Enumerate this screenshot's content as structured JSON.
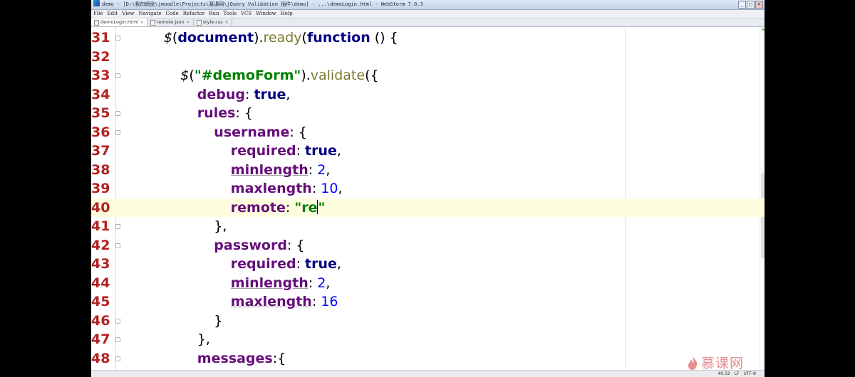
{
  "window": {
    "title": "demo - [D:\\我的網盘\\jmoodle\\Projects\\慕课网\\jQuery Validation 插件\\demo] - ...\\demoLogin.html - WebStorm 7.0.3",
    "controls": [
      "_",
      "□",
      "×"
    ]
  },
  "menu": [
    "File",
    "Edit",
    "View",
    "Navigate",
    "Code",
    "Refactor",
    "Run",
    "Tools",
    "VCS",
    "Window",
    "Help"
  ],
  "tabs": [
    {
      "label": "demoLogin.html",
      "close": "×",
      "active": true
    },
    {
      "label": "remote.json",
      "close": "×",
      "active": false
    },
    {
      "label": "style.css",
      "close": "×",
      "active": false
    }
  ],
  "code_lines": [
    {
      "num": "31",
      "tokens": [
        [
          "dollar",
          "$"
        ],
        [
          "pun",
          "("
        ],
        [
          "kw",
          "document"
        ],
        [
          "pun",
          ")."
        ],
        [
          "fn",
          "ready"
        ],
        [
          "pun",
          "("
        ],
        [
          "kw",
          "function"
        ],
        [
          "pun",
          " () {"
        ]
      ]
    },
    {
      "num": "32",
      "tokens": []
    },
    {
      "num": "33",
      "tokens": [
        [
          "dollar",
          "$"
        ],
        [
          "pun",
          "("
        ],
        [
          "str",
          "\"#demoForm\""
        ],
        [
          "pun",
          ")."
        ],
        [
          "fn",
          "validate"
        ],
        [
          "pun",
          "({"
        ]
      ]
    },
    {
      "num": "34",
      "tokens": [
        [
          "prop",
          "debug"
        ],
        [
          "pun",
          ": "
        ],
        [
          "kw",
          "true"
        ],
        [
          "pun",
          ","
        ]
      ]
    },
    {
      "num": "35",
      "tokens": [
        [
          "prop",
          "rules"
        ],
        [
          "pun",
          ": {"
        ]
      ]
    },
    {
      "num": "36",
      "tokens": [
        [
          "prop",
          "username"
        ],
        [
          "pun",
          ": {"
        ]
      ]
    },
    {
      "num": "37",
      "tokens": [
        [
          "prop",
          "required"
        ],
        [
          "pun",
          ": "
        ],
        [
          "kw",
          "true"
        ],
        [
          "pun",
          ","
        ]
      ]
    },
    {
      "num": "38",
      "tokens": [
        [
          "prop ul",
          "minlength"
        ],
        [
          "pun",
          ": "
        ],
        [
          "num",
          "2"
        ],
        [
          "pun",
          ","
        ]
      ]
    },
    {
      "num": "39",
      "tokens": [
        [
          "prop",
          "maxlength"
        ],
        [
          "pun",
          ": "
        ],
        [
          "num",
          "10"
        ],
        [
          "pun",
          ","
        ]
      ]
    },
    {
      "num": "40",
      "tokens": [
        [
          "prop",
          "remote"
        ],
        [
          "pun",
          ": "
        ],
        [
          "str",
          "\"re"
        ],
        [
          "caret",
          ""
        ],
        [
          "str",
          "\""
        ]
      ]
    },
    {
      "num": "41",
      "tokens": [
        [
          "pun",
          "},"
        ]
      ]
    },
    {
      "num": "42",
      "tokens": [
        [
          "prop",
          "password"
        ],
        [
          "pun",
          ": {"
        ]
      ]
    },
    {
      "num": "43",
      "tokens": [
        [
          "prop",
          "required"
        ],
        [
          "pun",
          ": "
        ],
        [
          "kw",
          "true"
        ],
        [
          "pun",
          ","
        ]
      ]
    },
    {
      "num": "44",
      "tokens": [
        [
          "prop ul",
          "minlength"
        ],
        [
          "pun",
          ": "
        ],
        [
          "num",
          "2"
        ],
        [
          "pun",
          ","
        ]
      ]
    },
    {
      "num": "45",
      "tokens": [
        [
          "prop ul",
          "maxlength"
        ],
        [
          "pun",
          ": "
        ],
        [
          "num",
          "16"
        ]
      ]
    },
    {
      "num": "46",
      "tokens": [
        [
          "pun",
          "}"
        ]
      ]
    },
    {
      "num": "47",
      "tokens": [
        [
          "pun",
          "},"
        ]
      ]
    },
    {
      "num": "48",
      "tokens": [
        [
          "prop",
          "messages"
        ],
        [
          "pun",
          ":{"
        ]
      ]
    }
  ],
  "current_line": "40",
  "status": {
    "position": "40:32",
    "line_sep": "LF",
    "encoding": "UTF-8"
  },
  "watermark": {
    "text": "慕课网",
    "icon": "flame-icon"
  }
}
